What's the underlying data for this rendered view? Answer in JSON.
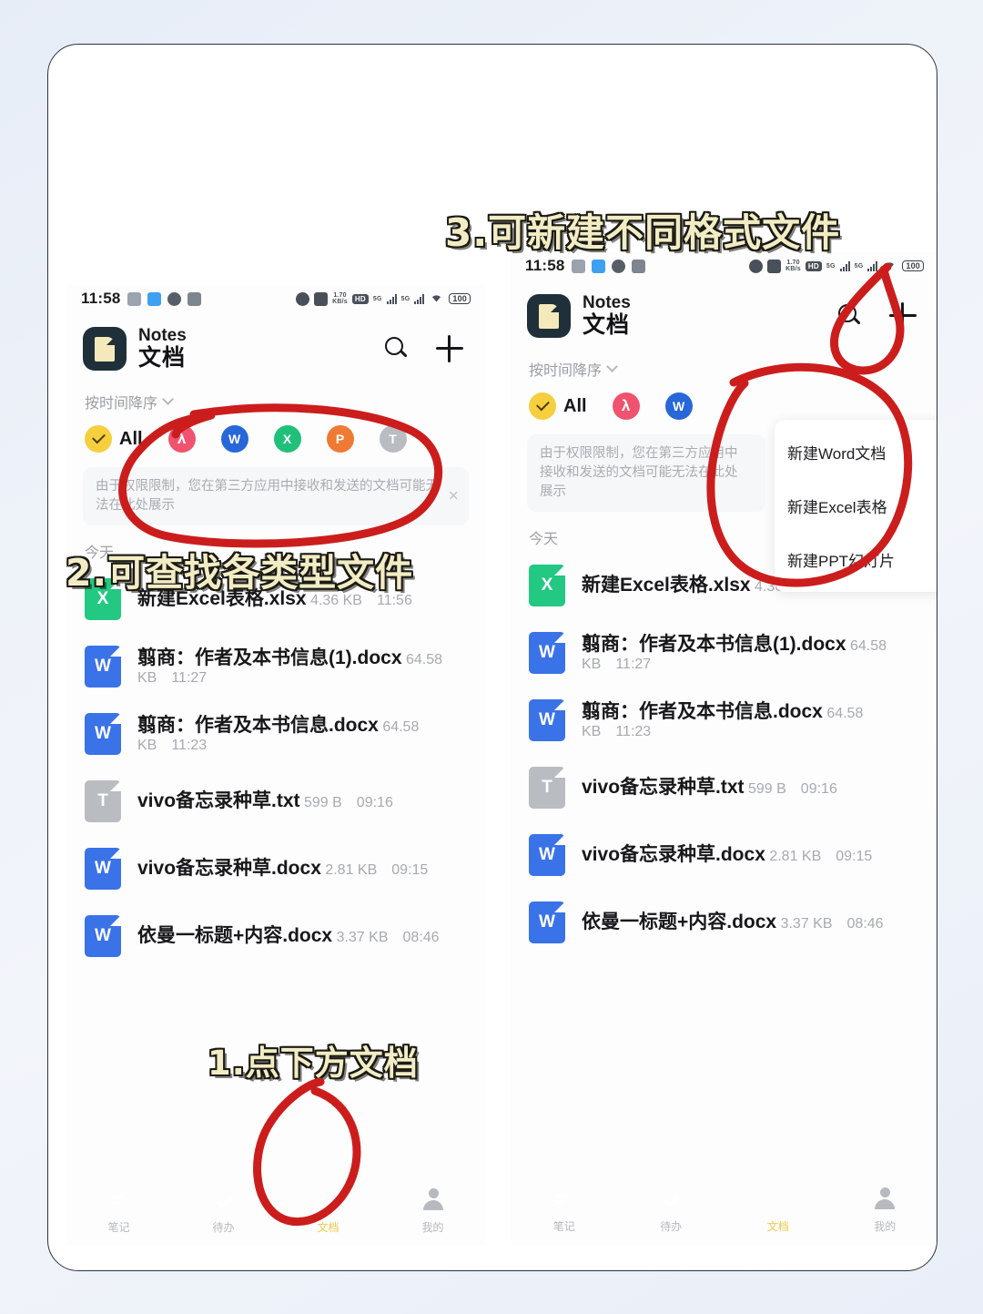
{
  "annotations": [
    {
      "id": "step1",
      "text": "1.点下方文档"
    },
    {
      "id": "step2",
      "text": "2.可查找各类型文件"
    },
    {
      "id": "step3",
      "text": "3.可新建不同格式文件"
    }
  ],
  "accent_colors": {
    "marker_red": "#cc1d1d",
    "caption_gold": "#f2ecc4",
    "caption_outline": "#1b1a14",
    "tab_active_yellow": "#eecb4a",
    "chip_all_yellow": "#f5cf3d"
  },
  "status_bar": {
    "time": "11:58",
    "battery": "100",
    "network_rate": "1.70",
    "network_unit": "KB/s",
    "hd_label": "HD",
    "sim1_label": "5G",
    "sim2_label": "5G",
    "left_icons": [
      "screenshot-icon",
      "app-blue-icon",
      "chat-icon",
      "gallery-icon"
    ],
    "right_icons": [
      "alarm-icon",
      "mute-icon",
      "data-rate-icon",
      "hd-icon",
      "signal-sim1-icon",
      "signal-sim2-icon",
      "wifi-icon",
      "battery-icon"
    ]
  },
  "app_header": {
    "name_en": "Notes",
    "name_cn": "文档",
    "search_icon": "search-icon",
    "add_icon": "plus-icon"
  },
  "sort": {
    "label": "按时间降序",
    "chevron": "chevron-down-icon"
  },
  "filters": [
    {
      "key": "all",
      "label": "All",
      "glyph": "✔",
      "color": "#f5cf3d",
      "icon": "check-icon"
    },
    {
      "key": "pdf",
      "label": "",
      "glyph": "λ",
      "color": "#f0536f",
      "icon": "pdf-icon"
    },
    {
      "key": "word",
      "label": "",
      "glyph": "W",
      "color": "#2767d8",
      "icon": "word-icon"
    },
    {
      "key": "excel",
      "label": "",
      "glyph": "X",
      "color": "#20c07a",
      "icon": "excel-icon"
    },
    {
      "key": "ppt",
      "label": "",
      "glyph": "P",
      "color": "#ef7a34",
      "icon": "ppt-icon"
    },
    {
      "key": "txt",
      "label": "",
      "glyph": "T",
      "color": "#b9bdc2",
      "icon": "txt-icon"
    }
  ],
  "notice": {
    "text": "由于权限限制，您在第三方应用中接收和发送的文档可能无法在此处展示",
    "close_label": "✕"
  },
  "section": {
    "today": "今天"
  },
  "files": [
    {
      "name": "新建Excel表格.xlsx",
      "size": "4.36 KB",
      "time": "11:56",
      "type": "excel",
      "glyph": "X"
    },
    {
      "name": "翦商：作者及本书信息(1).docx",
      "size": "64.58 KB",
      "time": "11:27",
      "type": "word",
      "glyph": "W"
    },
    {
      "name": "翦商：作者及本书信息.docx",
      "size": "64.58 KB",
      "time": "11:23",
      "type": "word",
      "glyph": "W"
    },
    {
      "name": "vivo备忘录种草.txt",
      "size": "599 B",
      "time": "09:16",
      "type": "txt",
      "glyph": "T"
    },
    {
      "name": "vivo备忘录种草.docx",
      "size": "2.81 KB",
      "time": "09:15",
      "type": "word",
      "glyph": "W"
    },
    {
      "name": "依曼一标题+内容.docx",
      "size": "3.37 KB",
      "time": "08:46",
      "type": "word",
      "glyph": "W"
    }
  ],
  "new_file_menu": [
    {
      "label": "新建Word文档"
    },
    {
      "label": "新建Excel表格"
    },
    {
      "label": "新建PPT幻灯片"
    }
  ],
  "tabbar": [
    {
      "key": "notes",
      "label": "笔记",
      "icon": "note-icon",
      "active": false
    },
    {
      "key": "todo",
      "label": "待办",
      "icon": "check-circle-icon",
      "active": false
    },
    {
      "key": "docs",
      "label": "文档",
      "icon": "document-icon",
      "active": true
    },
    {
      "key": "mine",
      "label": "我的",
      "icon": "person-icon",
      "active": false
    }
  ]
}
